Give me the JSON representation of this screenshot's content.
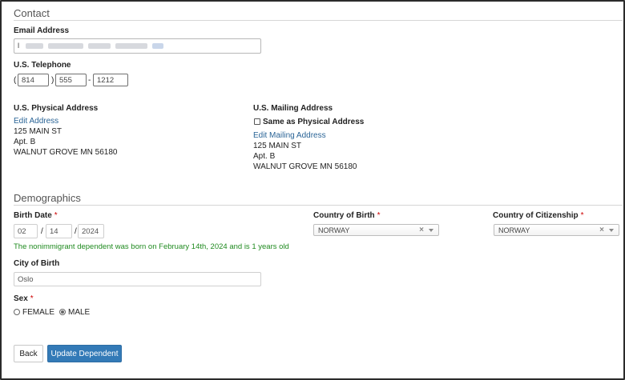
{
  "contact": {
    "title": "Contact",
    "email_label": "Email Address",
    "email_prefix": "l",
    "phone_label": "U.S. Telephone",
    "phone_open": "(",
    "phone_close": ")",
    "phone_dash": "-",
    "phone_area": "814",
    "phone_prefix": "555",
    "phone_line": "1212",
    "physical": {
      "label": "U.S. Physical Address",
      "edit_link": "Edit Address",
      "line1": "125 MAIN ST",
      "line2": "Apt. B",
      "line3": "WALNUT GROVE MN 56180"
    },
    "mailing": {
      "label": "U.S. Mailing Address",
      "same_label": "Same as Physical Address",
      "edit_link": "Edit Mailing Address",
      "line1": "125 MAIN ST",
      "line2": "Apt. B",
      "line3": "WALNUT GROVE MN 56180"
    }
  },
  "demographics": {
    "title": "Demographics",
    "required_mark": "*",
    "birth_date_label": "Birth Date",
    "birth_month": "02",
    "birth_day": "14",
    "birth_year": "2024",
    "date_sep": "/",
    "birth_hint": "The nonimmigrant dependent was born on February 14th, 2024 and is 1 years old",
    "country_birth_label": "Country of Birth",
    "country_birth_value": "NORWAY",
    "country_citizenship_label": "Country of Citizenship",
    "country_citizenship_value": "NORWAY",
    "clear_glyph": "×",
    "city_label": "City of Birth",
    "city_value": "Oslo",
    "sex_label": "Sex",
    "sex_female": "FEMALE",
    "sex_male": "MALE",
    "sex_selected": "MALE"
  },
  "actions": {
    "back": "Back",
    "update": "Update Dependent"
  },
  "colors": {
    "link": "#2a6496",
    "primary": "#337ab7",
    "hint": "#1f8a1f",
    "required": "#cc0000"
  }
}
